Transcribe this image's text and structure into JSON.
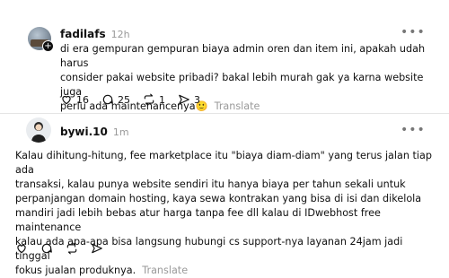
{
  "posts": [
    {
      "username": "fadilafs",
      "time": "12h",
      "text": "di era gempuran gempuran biaya admin oren dan item ini, apakah udah harus\nconsider pakai website pribadi? bakal lebih murah gak ya karna website juga\nperlu ada maintenancenya🙂",
      "translate_label": "Translate",
      "actions": {
        "likes": "16",
        "replies": "25",
        "reposts": "1",
        "shares": "3"
      }
    },
    {
      "username": "bywi.10",
      "time": "1m",
      "text": "Kalau dihitung-hitung, fee marketplace itu \"biaya diam-diam\" yang terus jalan tiap ada\ntransaksi, kalau punya website sendiri itu hanya biaya per tahun sekali untuk\nperpanjangan domain hosting, kaya sewa kontrakan yang bisa di isi dan dikelola\nmandiri jadi lebih bebas atur harga tanpa fee dll kalau di IDwebhost free maintenance\nkalau ada apa-apa bisa langsung hubungi cs support-nya layanan 24jam jadi tinggal\nfokus jualan produknya.",
      "translate_label": "Translate"
    }
  ],
  "icons": {
    "more": "more-horizontal-icon",
    "like": "heart-icon",
    "reply": "comment-icon",
    "repost": "repost-icon",
    "share": "send-icon",
    "follow": "plus-icon"
  }
}
